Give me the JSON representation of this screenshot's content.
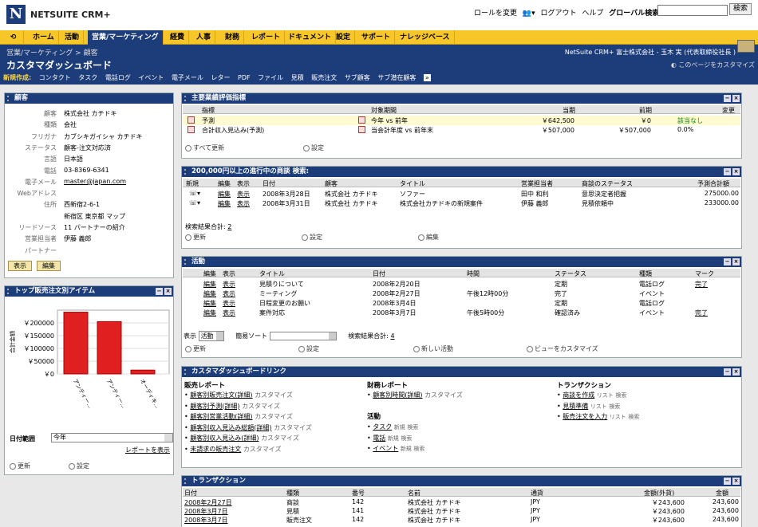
{
  "topbar": {
    "logo_text": "NETSUITE CRM+",
    "links": [
      "ロールを変更",
      "ログアウト",
      "ヘルプ",
      "グローバル検索"
    ],
    "search_button": "検索"
  },
  "nav": [
    "ホーム",
    "活動",
    "営業/マーケティング",
    "経費",
    "人事",
    "財務",
    "レポート",
    "ドキュメント",
    "設定",
    "サポート",
    "ナレッジベース"
  ],
  "header": {
    "breadcrumb": "営業/マーケティング > 顧客",
    "title": "カスタマダッシュボード",
    "company": "NetSuite CRM+ 富士株式会社 - 玉木 実 (代表取締役社長 )",
    "customize": "このページをカスタマイズ"
  },
  "newbar": {
    "label": "新規作成:",
    "items": [
      "コンタクト",
      "タスク",
      "電話ログ",
      "イベント",
      "電子メール",
      "レター",
      "PDF",
      "ファイル",
      "見積",
      "販売注文",
      "サブ顧客",
      "サブ潜在顧客"
    ]
  },
  "customer": {
    "title": "顧客",
    "fields": [
      {
        "k": "顧客",
        "v": "株式会社 カチドキ"
      },
      {
        "k": "種類",
        "v": "会社"
      },
      {
        "k": "フリガナ",
        "v": "カブシキガイシャ カチドキ"
      },
      {
        "k": "ステータス",
        "v": "顧客-注文対応済"
      },
      {
        "k": "言語",
        "v": "日本語"
      },
      {
        "k": "電話",
        "v": "03-8369-6341"
      },
      {
        "k": "電子メール",
        "v": "master@japan.com"
      },
      {
        "k": "Webアドレス",
        "v": ""
      },
      {
        "k": "住所",
        "v": "西新宿2-6-1"
      },
      {
        "k": "",
        "v": "新宿区 東京都 マップ"
      },
      {
        "k": "リードソース",
        "v": "11 パートナーの紹介"
      },
      {
        "k": "営業担当者",
        "v": "伊藤 義郎"
      },
      {
        "k": "パートナー",
        "v": ""
      }
    ],
    "btn_view": "表示",
    "btn_edit": "編集"
  },
  "topitems": {
    "title": "トップ販売注文別アイテム",
    "ylabel": "合計金額",
    "date_label": "日付範囲",
    "date_value": "今年",
    "report_link": "レポートを表示",
    "refresh": "更新",
    "settings": "設定"
  },
  "chart_data": {
    "type": "bar",
    "categories": [
      "アンティー...",
      "アンティー...",
      "オーディキ..."
    ],
    "values": [
      242000,
      205000,
      15000
    ],
    "ylim": [
      0,
      250000
    ],
    "ticks": [
      "￥0",
      "￥50000",
      "￥100000",
      "￥150000",
      "￥200000"
    ],
    "ylabel": "合計金額",
    "color": "#e02020"
  },
  "kpi": {
    "title": "主要業績評価指標",
    "headers": [
      "指標",
      "対象期間",
      "当期",
      "前期",
      "変更"
    ],
    "rows": [
      {
        "name": "予測",
        "period": "今年 vs 前年",
        "cur": "￥642,500",
        "prev": "￥0",
        "chg": "該当なし"
      },
      {
        "name": "合計収入見込み(予測)",
        "period": "当会計年度 vs 前年末",
        "cur": "￥507,000",
        "prev": "￥507,000",
        "chg": "0.0%"
      }
    ],
    "refresh": "すべて更新",
    "settings": "設定"
  },
  "opps": {
    "title": "200,000円以上の進行中の商談 検索:",
    "headers": [
      "新規",
      "編集",
      "表示",
      "日付",
      "顧客",
      "タイトル",
      "営業担当者",
      "商談のステータス",
      "予測合計額"
    ],
    "rows": [
      {
        "edit": "編集",
        "view": "表示",
        "date": "2008年3月28日",
        "cust": "株式会社 カチドキ",
        "title": "ソファー",
        "rep": "田中 和利",
        "status": "意思決定者把握",
        "amt": "275000.00"
      },
      {
        "edit": "編集",
        "view": "表示",
        "date": "2008年3月31日",
        "cust": "株式会社 カチドキ",
        "title": "株式会社カチドキの新規案件",
        "rep": "伊藤 義郎",
        "status": "見積依頼中",
        "amt": "233000.00"
      }
    ],
    "total_label": "検索結果合計:",
    "total": "2",
    "refresh": "更新",
    "settings": "設定",
    "edit": "編集"
  },
  "acts": {
    "title": "活動",
    "headers": [
      "編集",
      "表示",
      "タイトル",
      "日付",
      "時間",
      "ステータス",
      "種類",
      "マーク"
    ],
    "rows": [
      {
        "edit": "編集",
        "view": "表示",
        "title": "見積りについて",
        "date": "2008年2月20日",
        "time": "",
        "status": "定期",
        "type": "電話ログ",
        "mark": "完了"
      },
      {
        "edit": "編集",
        "view": "表示",
        "title": "ミーティング",
        "date": "2008年2月27日",
        "time": "午後12時00分",
        "status": "完了",
        "type": "イベント",
        "mark": ""
      },
      {
        "edit": "編集",
        "view": "表示",
        "title": "日程変更のお願い",
        "date": "2008年3月4日",
        "time": "",
        "status": "定期",
        "type": "電話ログ",
        "mark": ""
      },
      {
        "edit": "編集",
        "view": "表示",
        "title": "案件対応",
        "date": "2008年3月7日",
        "time": "午後5時00分",
        "status": "確認済み",
        "type": "イベント",
        "mark": "完了"
      }
    ],
    "view_label": "表示",
    "view_value": "活動",
    "sort_label": "簡易ソート",
    "total_label": "検索結果合計:",
    "total": "4",
    "refresh": "更新",
    "settings": "設定",
    "new": "新しい活動",
    "customize": "ビューをカスタマイズ"
  },
  "links": {
    "title": "カスタマダッシュボードリンク",
    "sales_h": "販売レポート",
    "sales": [
      "顧客別販売注文(詳細)",
      "顧客別予測(詳細)",
      "顧客別営業活動(詳細)",
      "顧客別収入見込み総額(詳細)",
      "顧客別収入見込み(詳細)",
      "未請求の販売注文"
    ],
    "cust": "カスタマイズ",
    "fin_h": "財務レポート",
    "fin": [
      "顧客別時間(詳細)"
    ],
    "act_h": "活動",
    "acts": [
      "タスク",
      "電話",
      "イベント"
    ],
    "tr_h": "トランザクション",
    "trs": [
      "商談を作成",
      "見積準備",
      "販売注文を入力"
    ],
    "new": "新規",
    "search": "検索",
    "list": "リスト"
  },
  "trans": {
    "title": "トランザクション",
    "headers": [
      "日付",
      "種類",
      "番号",
      "名前",
      "通貨",
      "金額(外貨)",
      "金額"
    ],
    "rows": [
      {
        "date": "2008年2月27日",
        "type": "商談",
        "num": "142",
        "name": "株式会社 カチドキ",
        "cur": "JPY",
        "fx": "￥243,600",
        "amt": "243,600"
      },
      {
        "date": "2008年3月7日",
        "type": "見積",
        "num": "141",
        "name": "株式会社 カチドキ",
        "cur": "JPY",
        "fx": "￥243,600",
        "amt": "243,600"
      },
      {
        "date": "2008年3月7日",
        "type": "販売注文",
        "num": "142",
        "name": "株式会社 カチドキ",
        "cur": "JPY",
        "fx": "￥243,600",
        "amt": "243,600"
      }
    ]
  }
}
